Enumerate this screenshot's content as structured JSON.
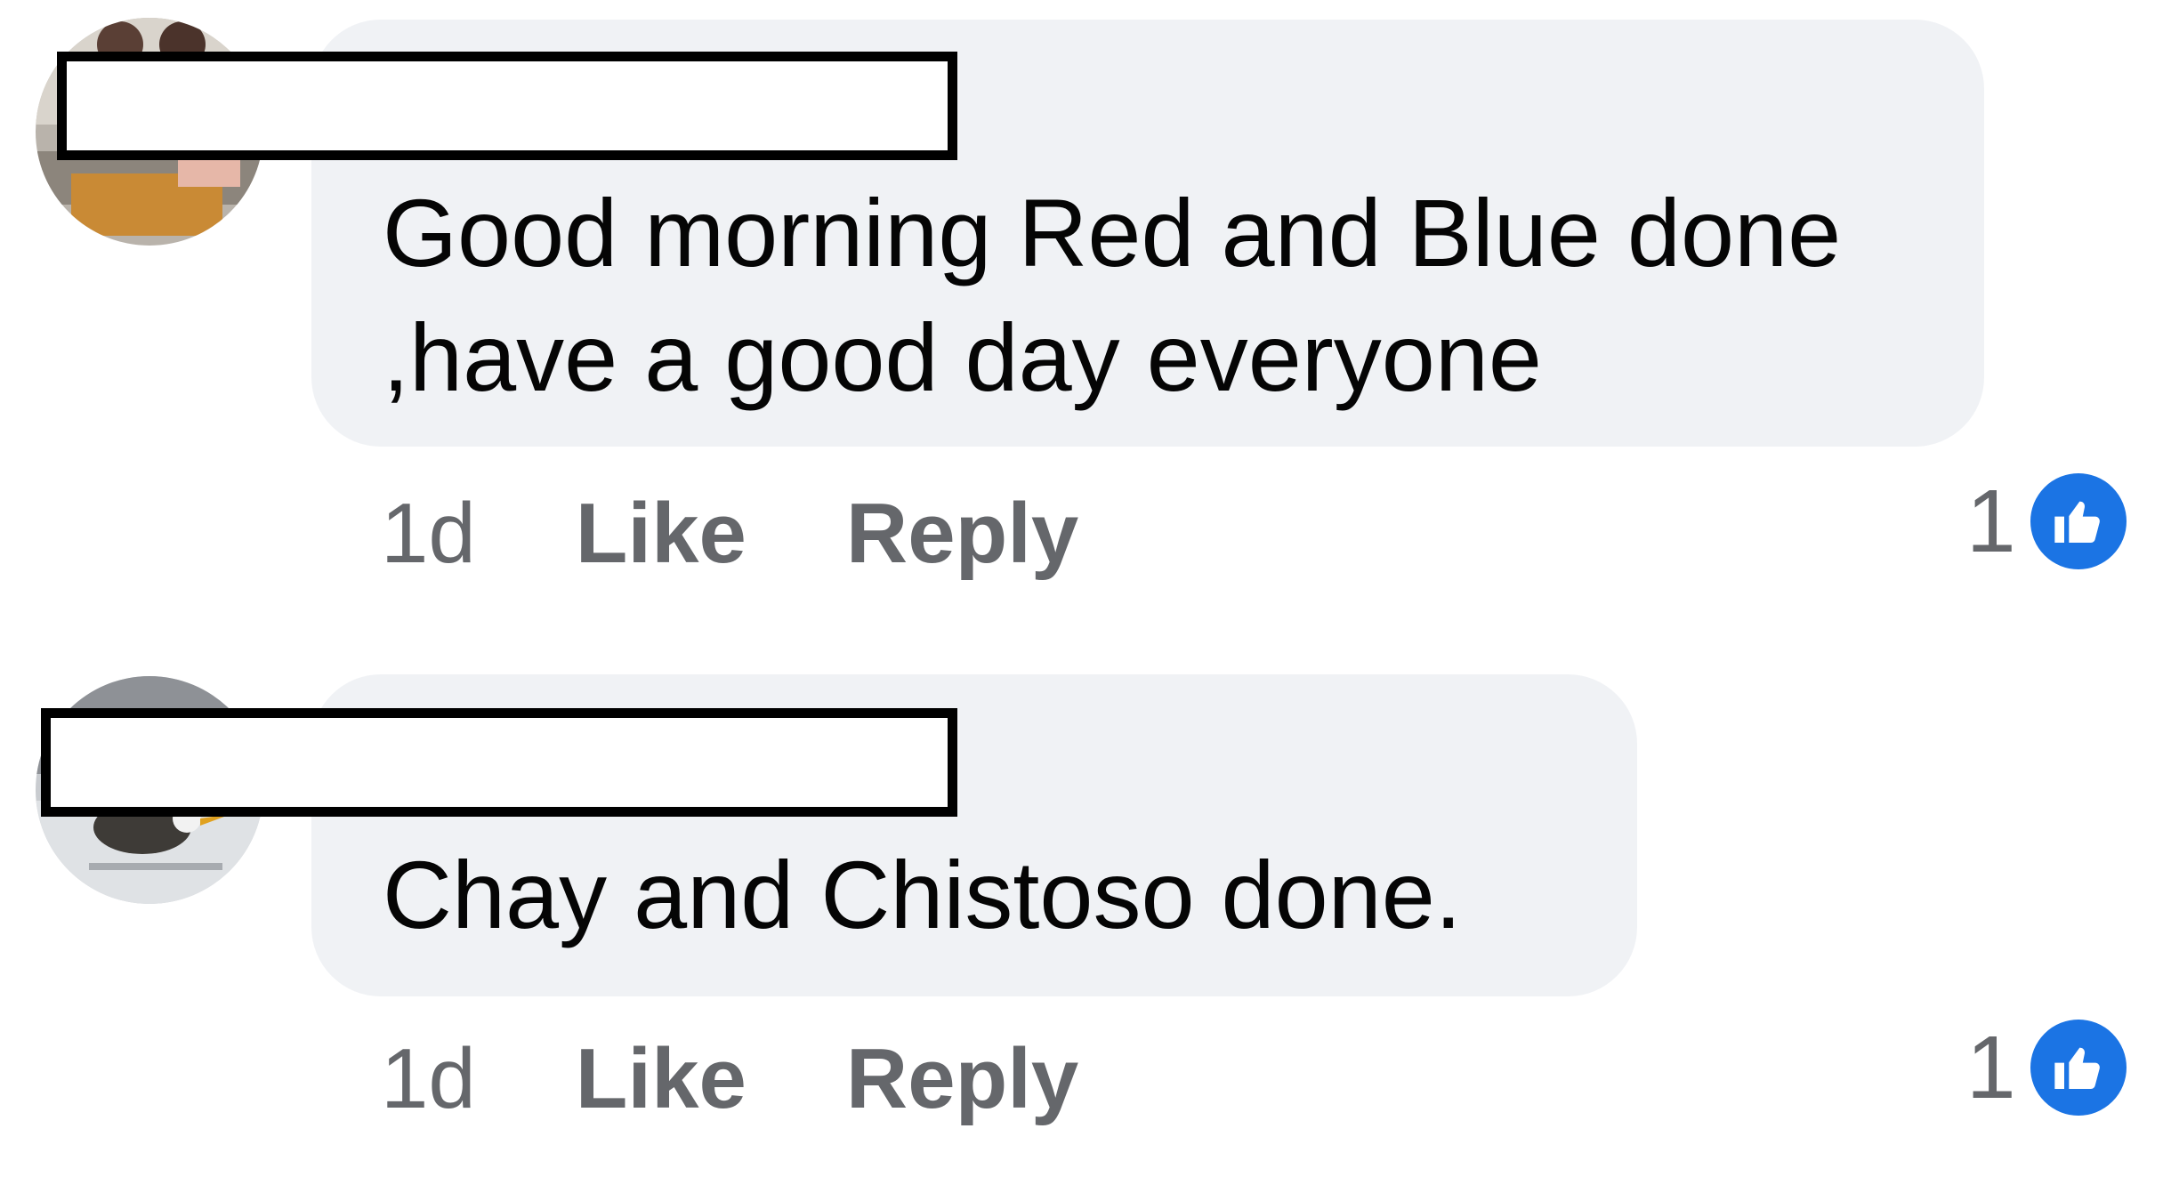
{
  "comments": [
    {
      "text": "Good morning Red and Blue done ,have a good day everyone",
      "time": "1d",
      "like_label": "Like",
      "reply_label": "Reply",
      "reaction_count": "1",
      "reaction_icon": "thumbs-up-icon"
    },
    {
      "text": "Chay and Chistoso done.",
      "time": "1d",
      "like_label": "Like",
      "reply_label": "Reply",
      "reaction_count": "1",
      "reaction_icon": "thumbs-up-icon"
    }
  ],
  "colors": {
    "bubble": "#f0f2f5",
    "text": "#050505",
    "meta": "#65676b",
    "reaction_badge": "#1b74e4",
    "redaction_border": "#000000"
  }
}
